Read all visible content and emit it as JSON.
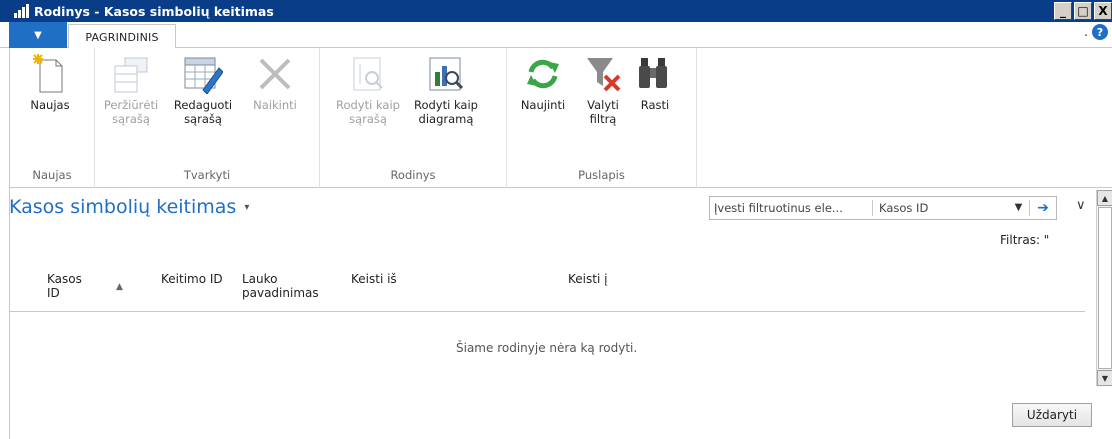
{
  "window": {
    "title": "Rodinys - Kasos simbolių keitimas",
    "controls": [
      "_",
      "□",
      "X"
    ]
  },
  "tabs": {
    "menu_arrow": "▼",
    "home": "PAGRINDINIS",
    "help_dot": ".",
    "help": "?"
  },
  "ribbon": {
    "groups": [
      {
        "label": "Naujas",
        "buttons": [
          {
            "label": "Naujas",
            "icon": "new-document-icon",
            "enabled": true
          }
        ]
      },
      {
        "label": "Tvarkyti",
        "buttons": [
          {
            "label": "Peržiūrėti\nsąrašą",
            "icon": "view-list-icon",
            "enabled": false
          },
          {
            "label": "Redaguoti\nsąrašą",
            "icon": "edit-list-icon",
            "enabled": true
          },
          {
            "label": "Naikinti",
            "icon": "delete-icon",
            "enabled": false
          }
        ]
      },
      {
        "label": "Rodinys",
        "buttons": [
          {
            "label": "Rodyti kaip\nsąrašą",
            "icon": "show-as-list-icon",
            "enabled": false
          },
          {
            "label": "Rodyti kaip\ndiagramą",
            "icon": "show-as-chart-icon",
            "enabled": true
          }
        ]
      },
      {
        "label": "Puslapis",
        "buttons": [
          {
            "label": "Naujinti",
            "icon": "refresh-icon",
            "enabled": true
          },
          {
            "label": "Valyti\nfiltrą",
            "icon": "clear-filter-icon",
            "enabled": true
          },
          {
            "label": "Rasti",
            "icon": "binoculars-icon",
            "enabled": true
          }
        ]
      }
    ]
  },
  "list": {
    "title": "Kasos simbolių keitimas",
    "title_caret": "▾",
    "filter_placeholder": "Įvesti filtruotinus ele...",
    "filter_field": "Kasos ID",
    "filter_status": "Filtras: \"",
    "columns": [
      "Kasos\nID",
      "Keitimo ID",
      "Lauko\npavadinimas",
      "Keisti iš",
      "Keisti į"
    ],
    "empty_message": "Šiame rodinyje nėra ką rodyti."
  },
  "footer": {
    "close_label": "Uždaryti"
  },
  "colors": {
    "titlebar": "#0a3d88",
    "accent": "#1f6fc5",
    "refresh_green": "#3aa64a",
    "clear_filter_red": "#d83a2a"
  }
}
